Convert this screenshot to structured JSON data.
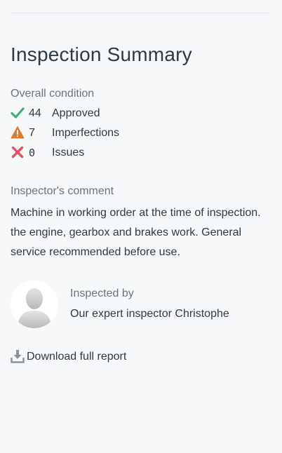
{
  "summary": {
    "title": "Inspection Summary"
  },
  "condition": {
    "label": "Overall condition",
    "approved": {
      "count": "44",
      "label": "Approved",
      "icon": "check-icon",
      "color": "#3bb273"
    },
    "imperfections": {
      "count": "7",
      "label": "Imperfections",
      "icon": "warning-icon",
      "color": "#e07b2e"
    },
    "issues": {
      "count": "0",
      "label": "Issues",
      "icon": "close-icon",
      "color": "#e5505c"
    }
  },
  "comment": {
    "label": "Inspector's comment",
    "text": "Machine in working order at the time of inspection. the engine, gearbox and brakes work. General service recommended before use."
  },
  "inspector": {
    "label": "Inspected by",
    "name": "Our expert inspector Christophe",
    "avatar_icon": "user-avatar-placeholder"
  },
  "download": {
    "label": "Download full report",
    "icon": "download-icon",
    "icon_color": "#8a929b"
  }
}
